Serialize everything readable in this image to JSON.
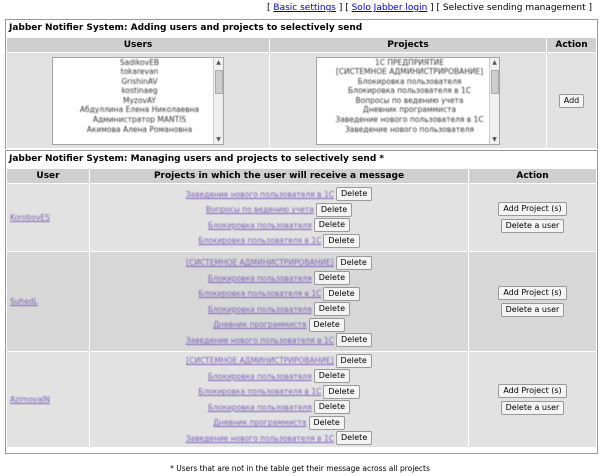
{
  "nav": {
    "basic_settings": "Basic settings",
    "solo_login": "Solo Jabber login",
    "selective": "Selective sending management"
  },
  "adding": {
    "title": "Jabber Notifier System: Adding users and projects to selectively send",
    "col_users": "Users",
    "col_projects": "Projects",
    "col_action": "Action",
    "users": [
      "SadikovEB",
      "tokarevan",
      "GrishinAV",
      "kostinaeg",
      "MyzovAY",
      "Абдуллина Елена Николаевна",
      "Администратор MANTIS",
      "Акимова Алена Романовна"
    ],
    "projects": [
      "1С ПРЕДПРИЯТИЕ",
      "[СИСТЕМНОЕ АДМИНИСТРИРОВАНИЕ]",
      "Блокировка пользователя",
      "Блокировка пользователя в 1С",
      "Вопросы по ведению учета",
      "Дневник программиста",
      "Заведение нового пользователя в 1С",
      "Заведение нового пользователя"
    ],
    "add_button": "Add"
  },
  "managing": {
    "title": "Jabber Notifier System: Managing users and projects to selectively send *",
    "col_user": "User",
    "col_projects": "Projects in which the user will receive a message",
    "col_action": "Action",
    "delete_label": "Delete",
    "add_projects_label": "Add Project (s)",
    "delete_user_label": "Delete a user",
    "rows": [
      {
        "user": "KorobovES",
        "projects": [
          "Заведение нового пользователя в 1С",
          "Вопросы по ведению учета",
          "Блокировка пользователя",
          "Блокировка пользователя в 1С"
        ]
      },
      {
        "user": "SuhedL",
        "projects": [
          "[СИСТЕМНОЕ АДМИНИСТРИРОВАНИЕ]",
          "Блокировка пользователя",
          "Блокировка пользователя в 1С",
          "Блокировка пользователя",
          "Дневник программиста",
          "Заведение нового пользователя в 1С"
        ]
      },
      {
        "user": "AzimovaIN",
        "projects": [
          "[СИСТЕМНОЕ АДМИНИСТРИРОВАНИЕ]",
          "Блокировка пользователя",
          "Блокировка пользователя в 1С",
          "Блокировка пользователя",
          "Дневник программиста",
          "Заведение нового пользователя в 1С"
        ]
      }
    ]
  },
  "footnote": "* Users that are not in the table get their message across all projects"
}
